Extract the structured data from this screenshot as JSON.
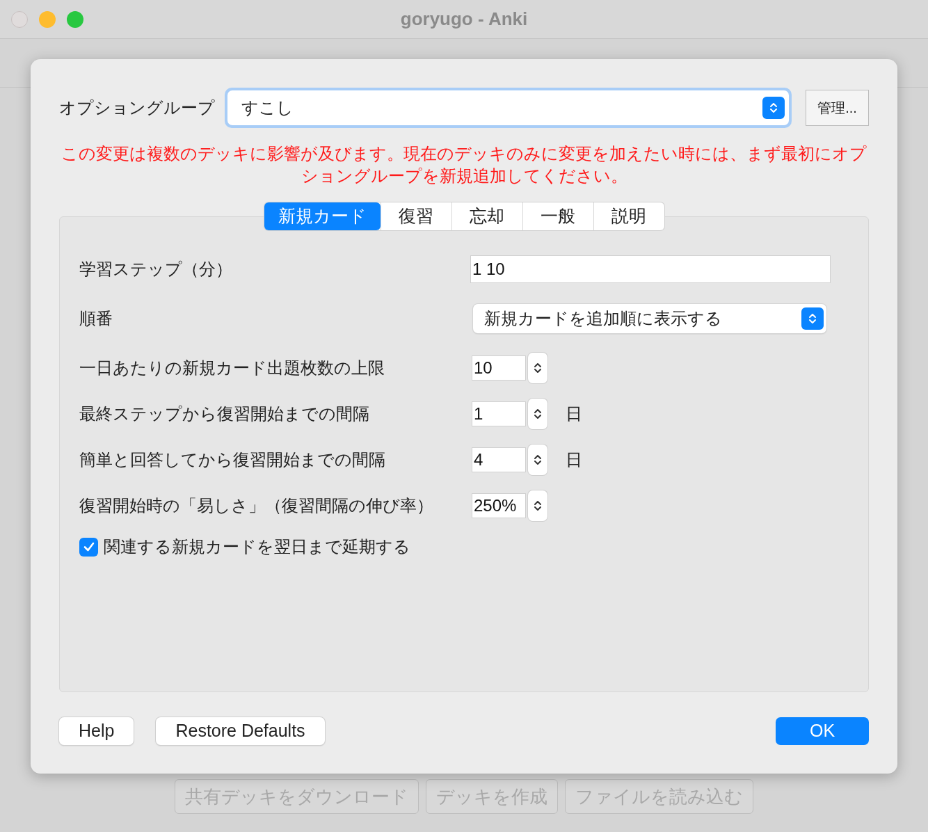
{
  "window": {
    "title": "goryugo - Anki"
  },
  "dialog": {
    "option_group": {
      "label": "オプショングループ",
      "value": "すこし",
      "manage_button": "管理..."
    },
    "warning": "この変更は複数のデッキに影響が及びます。現在のデッキのみに変更を加えたい時には、まず最初にオプショングループを新規追加してください。",
    "tabs": [
      {
        "label": "新規カード",
        "selected": true
      },
      {
        "label": "復習",
        "selected": false
      },
      {
        "label": "忘却",
        "selected": false
      },
      {
        "label": "一般",
        "selected": false
      },
      {
        "label": "説明",
        "selected": false
      }
    ],
    "settings": [
      {
        "kind": "text",
        "label": "学習ステップ（分）",
        "value": "1 10"
      },
      {
        "kind": "select",
        "label": "順番",
        "value": "新規カードを追加順に表示する"
      },
      {
        "kind": "spin",
        "label": "一日あたりの新規カード出題枚数の上限",
        "value": "10"
      },
      {
        "kind": "spin",
        "label": "最終ステップから復習開始までの間隔",
        "value": "1",
        "unit": "日"
      },
      {
        "kind": "spin",
        "label": "簡単と回答してから復習開始までの間隔",
        "value": "4",
        "unit": "日"
      },
      {
        "kind": "spin",
        "label": "復習開始時の「易しさ」（復習間隔の伸び率）",
        "value": "250%"
      },
      {
        "kind": "checkbox",
        "label": "関連する新規カードを翌日まで延期する",
        "checked": true
      }
    ],
    "buttons": [
      {
        "label": "Help",
        "kind": "plain"
      },
      {
        "label": "Restore Defaults",
        "kind": "plain"
      },
      {
        "label": "OK",
        "kind": "default"
      }
    ]
  },
  "background_buttons": [
    {
      "label": "共有デッキをダウンロード",
      "disabled": true
    },
    {
      "label": "デッキを作成",
      "disabled": true
    },
    {
      "label": "ファイルを読み込む",
      "disabled": true
    }
  ]
}
